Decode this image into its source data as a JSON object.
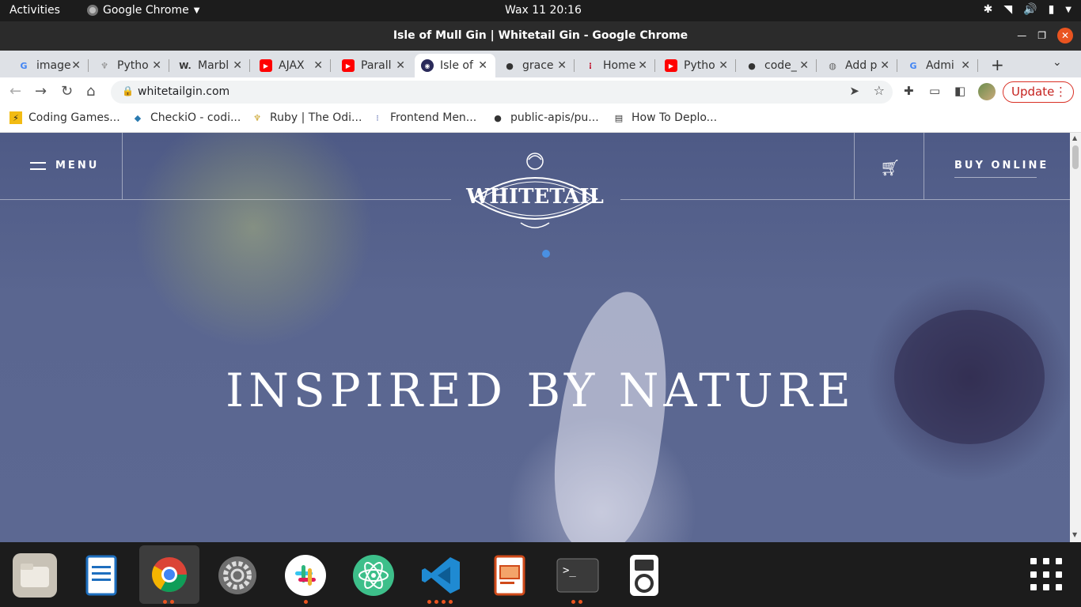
{
  "system": {
    "activities": "Activities",
    "app_name": "Google Chrome",
    "clock": "Wax 11  20:16"
  },
  "window": {
    "title": "Isle of Mull Gin | Whitetail Gin - Google Chrome"
  },
  "tabs": [
    {
      "label": "image",
      "icon": "google-icon",
      "color": "#4285f4"
    },
    {
      "label": "Pytho",
      "icon": "palm-icon",
      "color": "#888888"
    },
    {
      "label": "Marbl",
      "icon": "w-icon",
      "color": "#000000"
    },
    {
      "label": "AJAX",
      "icon": "youtube-icon",
      "color": "#ff0000"
    },
    {
      "label": "Parall",
      "icon": "youtube-icon",
      "color": "#ff0000"
    },
    {
      "label": "Isle of",
      "icon": "whitetail-icon",
      "color": "#2a2a5a"
    },
    {
      "label": "grace",
      "icon": "github-icon",
      "color": "#000000"
    },
    {
      "label": "Home",
      "icon": "hollow-icon",
      "color": "#c0102c"
    },
    {
      "label": "Pytho",
      "icon": "youtube-icon",
      "color": "#ff0000"
    },
    {
      "label": "code_",
      "icon": "github-icon",
      "color": "#000000"
    },
    {
      "label": "Add p",
      "icon": "globe-icon",
      "color": "#666666"
    },
    {
      "label": "Admi",
      "icon": "google-icon",
      "color": "#4285f4"
    }
  ],
  "toolbar": {
    "url": "whitetailgin.com",
    "update_label": "Update"
  },
  "bookmarks": [
    {
      "label": "Coding Games...",
      "icon": "codingame-icon"
    },
    {
      "label": "CheckiO - codi...",
      "icon": "checkio-icon"
    },
    {
      "label": "Ruby | The Odi...",
      "icon": "odin-icon"
    },
    {
      "label": "Frontend Men...",
      "icon": "frontend-mentor-icon"
    },
    {
      "label": "public-apis/pu...",
      "icon": "github-icon"
    },
    {
      "label": "How To Deplo...",
      "icon": "article-icon"
    }
  ],
  "site": {
    "menu_label": "MENU",
    "buy_label": "BUY ONLINE",
    "logo_text": "WHITETAIL",
    "hero": "INSPIRED BY NATURE"
  },
  "dock": [
    {
      "name": "files",
      "icon": "folder-icon"
    },
    {
      "name": "libreoffice-writer",
      "icon": "document-icon"
    },
    {
      "name": "google-chrome",
      "icon": "chrome-icon"
    },
    {
      "name": "settings",
      "icon": "gear-icon"
    },
    {
      "name": "slack",
      "icon": "slack-icon"
    },
    {
      "name": "atom",
      "icon": "atom-icon"
    },
    {
      "name": "vscode",
      "icon": "vscode-icon"
    },
    {
      "name": "libreoffice-impress",
      "icon": "presentation-icon"
    },
    {
      "name": "terminal",
      "icon": "terminal-icon"
    },
    {
      "name": "rhythmbox",
      "icon": "music-player-icon"
    }
  ]
}
